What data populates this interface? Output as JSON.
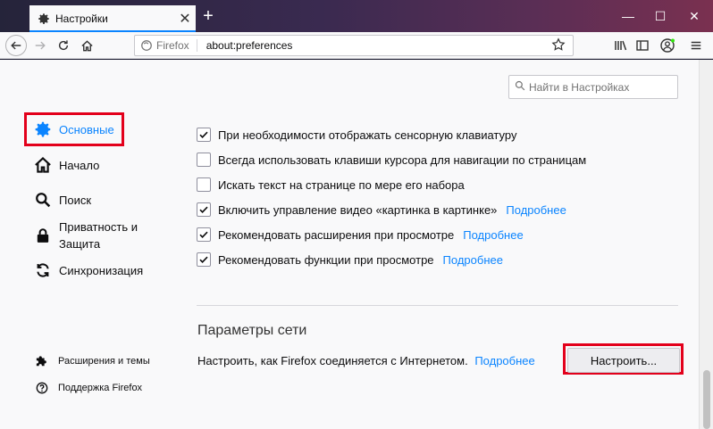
{
  "tab": {
    "title": "Настройки"
  },
  "urlbar": {
    "identity": "Firefox",
    "url": "about:preferences"
  },
  "search": {
    "placeholder": "Найти в Настройках"
  },
  "sidebar": {
    "items": [
      {
        "label": "Основные",
        "icon": "gear-icon"
      },
      {
        "label": "Начало",
        "icon": "home-icon"
      },
      {
        "label": "Поиск",
        "icon": "search-icon"
      },
      {
        "label": "Приватность и Защита",
        "label_line1": "Приватность и",
        "label_line2": "Защита",
        "icon": "lock-icon"
      },
      {
        "label": "Синхронизация",
        "icon": "sync-icon"
      }
    ],
    "footer": [
      {
        "label": "Расширения и темы",
        "icon": "puzzle-icon"
      },
      {
        "label": "Поддержка Firefox",
        "icon": "help-icon"
      }
    ]
  },
  "options": [
    {
      "label": "При необходимости отображать сенсорную клавиатуру",
      "checked": true,
      "link": ""
    },
    {
      "label": "Всегда использовать клавиши курсора для навигации по страницам",
      "checked": false,
      "link": ""
    },
    {
      "label": "Искать текст на странице по мере его набора",
      "checked": false,
      "link": ""
    },
    {
      "label": "Включить управление видео «картинка в картинке»",
      "checked": true,
      "link": "Подробнее"
    },
    {
      "label": "Рекомендовать расширения при просмотре",
      "checked": true,
      "link": "Подробнее"
    },
    {
      "label": "Рекомендовать функции при просмотре",
      "checked": true,
      "link": "Подробнее"
    }
  ],
  "network": {
    "title": "Параметры сети",
    "description": "Настроить, как Firefox соединяется с Интернетом.",
    "link": "Подробнее",
    "button": "Настроить..."
  },
  "colors": {
    "accent": "#0a84ff",
    "highlight": "#e3001b"
  }
}
